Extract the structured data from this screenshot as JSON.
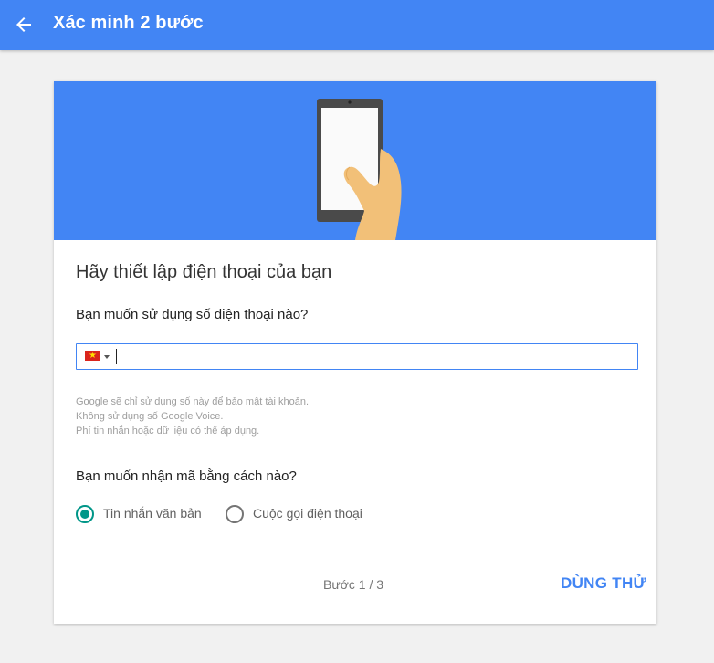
{
  "appbar": {
    "title": "Xác minh 2 bước",
    "back_icon": "arrow-left-icon",
    "color": "#4285f4"
  },
  "card": {
    "hero_illustration": "hand-holding-phone",
    "heading": "Hãy thiết lập điện thoại của bạn",
    "phone_question": "Bạn muốn sử dụng số điện thoại nào?",
    "phone_field": {
      "country_flag": "vietnam-flag-icon",
      "value": "",
      "placeholder": ""
    },
    "notes": [
      "Google sẽ chỉ sử dụng số này để bảo mật tài khoản.",
      "Không sử dụng số Google Voice.",
      "Phí tin nhắn hoặc dữ liệu có thể áp dụng."
    ],
    "method_question": "Bạn muốn nhận mã bằng cách nào?",
    "methods": [
      {
        "label": "Tin nhắn văn bản",
        "selected": true
      },
      {
        "label": "Cuộc gọi điện thoại",
        "selected": false
      }
    ],
    "step": "Bước 1 / 3",
    "try_button": "DÙNG THỬ",
    "accent": "#009688"
  }
}
